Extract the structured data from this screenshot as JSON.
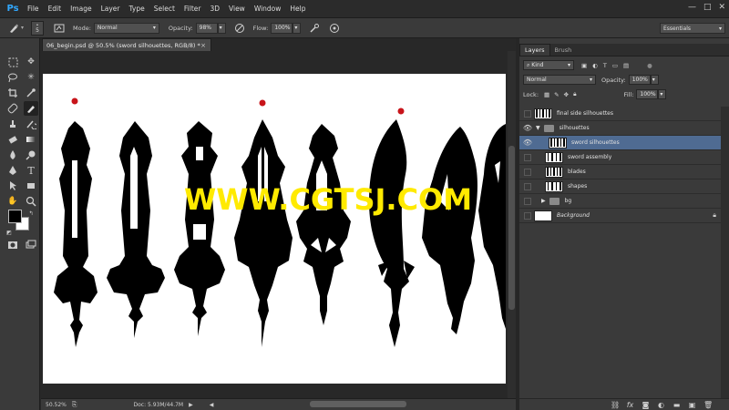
{
  "app": {
    "logo": "Ps"
  },
  "menu": [
    "File",
    "Edit",
    "Image",
    "Layer",
    "Type",
    "Select",
    "Filter",
    "3D",
    "View",
    "Window",
    "Help"
  ],
  "window_controls": {
    "minimize": "—",
    "maximize": "□",
    "close": "✕"
  },
  "options_bar": {
    "brush_size": "5",
    "mode_label": "Mode:",
    "mode_value": "Normal",
    "opacity_label": "Opacity:",
    "opacity_value": "98%",
    "flow_label": "Flow:",
    "flow_value": "100%",
    "workspace": "Essentials"
  },
  "document": {
    "tab_title": "06_begin.psd @ 50.5% (sword silhouettes, RGB/8) *",
    "close": "×",
    "zoom": "50.52%",
    "doc_size": "Doc: 5.93M/44.7M"
  },
  "watermark": "WWW.CGTSJ.COM",
  "layers_panel": {
    "tabs": [
      "Layers",
      "Brush"
    ],
    "filter_kind": "Kind",
    "blend_mode": "Normal",
    "opacity_label": "Opacity:",
    "opacity_value": "100%",
    "lock_label": "Lock:",
    "fill_label": "Fill:",
    "fill_value": "100%",
    "layers": [
      {
        "name": "final side silhouettes",
        "visible": false,
        "kind": "layer"
      },
      {
        "name": "silhouettes",
        "visible": true,
        "kind": "group",
        "expanded": true
      },
      {
        "name": "sword silhouettes",
        "visible": true,
        "kind": "layer",
        "selected": true
      },
      {
        "name": "sword assembly",
        "visible": false,
        "kind": "layer"
      },
      {
        "name": "blades",
        "visible": false,
        "kind": "layer"
      },
      {
        "name": "shapes",
        "visible": false,
        "kind": "layer"
      },
      {
        "name": "bg",
        "visible": false,
        "kind": "group",
        "expanded": false
      },
      {
        "name": "Background",
        "visible": false,
        "kind": "background",
        "locked": true
      }
    ]
  },
  "colors": {
    "accent_selected": "#4f6b92",
    "watermark": "#ffea00",
    "marker": "#c8141a"
  }
}
